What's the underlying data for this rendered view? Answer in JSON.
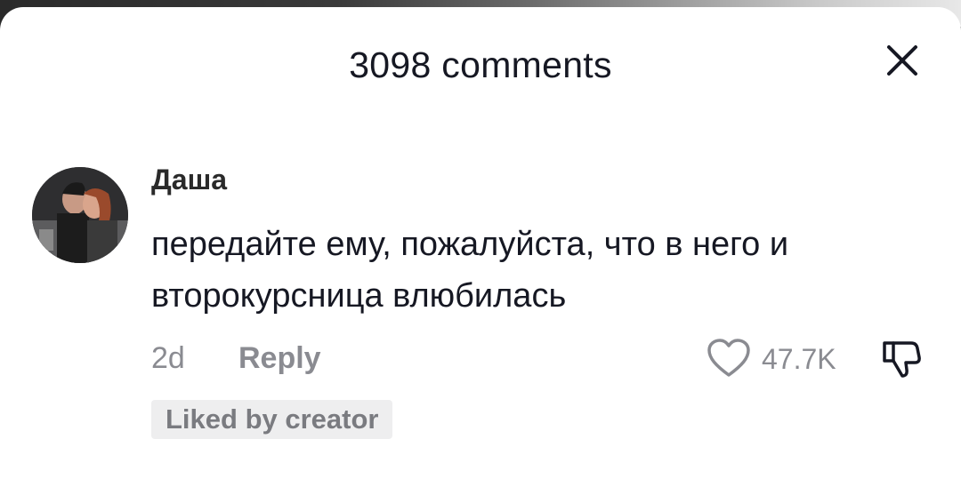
{
  "header": {
    "title": "3098 comments"
  },
  "comment": {
    "username": "Даша",
    "text": "передайте ему, пожалуйста, что в него и второкурсница влюбилась",
    "time": "2d",
    "reply_label": "Reply",
    "like_count": "47.7K",
    "badge": "Liked by creator"
  },
  "icons": {
    "close": "close-icon",
    "like": "heart-outline-icon",
    "dislike": "thumbs-down-icon"
  },
  "colors": {
    "text_primary": "#161823",
    "text_secondary": "#8a8b91",
    "badge_bg": "#eeeeef"
  }
}
